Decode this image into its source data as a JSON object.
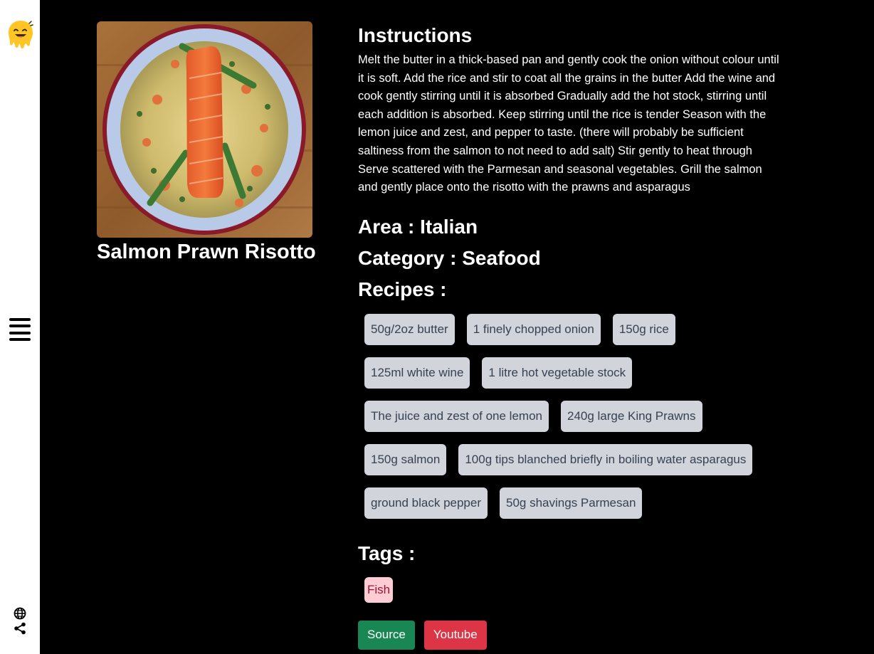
{
  "sidebar": {
    "logo": "smiling-face-logo",
    "menu_icon": "hamburger-menu-icon",
    "globe_icon": "globe-icon",
    "share_icon": "share-icon"
  },
  "meal": {
    "title": "Salmon Prawn Risotto",
    "image_description": "salmon-prawn-risotto-photo"
  },
  "instructions": {
    "heading": "Instructions",
    "text": "Melt the butter in a thick-based pan and gently cook the onion without colour until it is soft. Add the rice and stir to coat all the grains in the butter Add the wine and cook gently stirring until it is absorbed Gradually add the hot stock, stirring until each addition is absorbed. Keep stirring until the rice is tender Season with the lemon juice and zest, and pepper to taste. (there will probably be sufficient saltiness from the salmon to not need to add salt) Stir gently to heat through Serve scattered with the Parmesan and seasonal vegetables. Grill the salmon and gently place onto the risotto with the prawns and asparagus"
  },
  "area": {
    "label": "Area : Italian"
  },
  "category": {
    "label": "Category : Seafood"
  },
  "recipes": {
    "heading": "Recipes :",
    "ingredients": [
      "50g/2oz butter",
      "1 finely chopped onion",
      "150g rice",
      "125ml white wine",
      "1 litre hot vegetable stock",
      "The juice and zest of one lemon",
      "240g large King Prawns",
      "150g salmon",
      "100g tips blanched briefly in boiling water asparagus",
      "ground black pepper",
      "50g shavings Parmesan"
    ]
  },
  "tags": {
    "heading": "Tags :",
    "items": [
      "Fish"
    ]
  },
  "buttons": {
    "source_label": "Source",
    "youtube_label": "Youtube"
  },
  "colors": {
    "page_background": "#000000",
    "sidebar_background": "#ffffff",
    "ingredient_badge_bg": "#d1d5db",
    "ingredient_badge_text": "#374151",
    "tag_badge_bg": "#fecdd3",
    "tag_badge_text": "#9f1239",
    "source_button": "#198754",
    "youtube_button": "#dc3545"
  }
}
